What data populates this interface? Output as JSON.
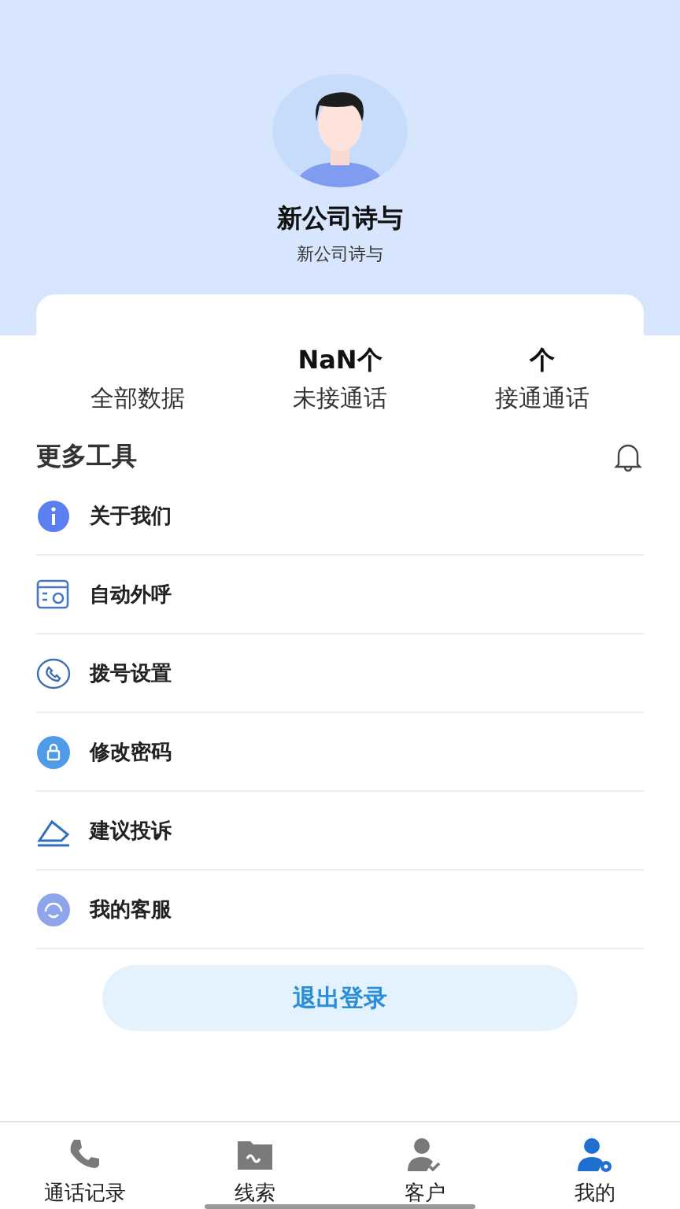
{
  "profile": {
    "name": "新公司诗与",
    "subtitle": "新公司诗与"
  },
  "stats": [
    {
      "label": "全部数据"
    },
    {
      "value": "NaN个",
      "label": "未接通话"
    },
    {
      "value": "个",
      "label": "接通通话"
    }
  ],
  "tools": {
    "title": "更多工具",
    "items": [
      {
        "kind": "info",
        "label": "关于我们"
      },
      {
        "kind": "auto",
        "label": "自动外呼"
      },
      {
        "kind": "dial",
        "label": "拨号设置"
      },
      {
        "kind": "lock",
        "label": "修改密码"
      },
      {
        "kind": "feedback",
        "label": "建议投诉"
      },
      {
        "kind": "service",
        "label": "我的客服"
      }
    ]
  },
  "logout": "退出登录",
  "tabs": [
    {
      "kind": "calls",
      "label": "通话记录",
      "selected": false
    },
    {
      "kind": "leads",
      "label": "线索",
      "selected": false
    },
    {
      "kind": "customers",
      "label": "客户",
      "selected": false
    },
    {
      "kind": "me",
      "label": "我的",
      "selected": true
    }
  ]
}
